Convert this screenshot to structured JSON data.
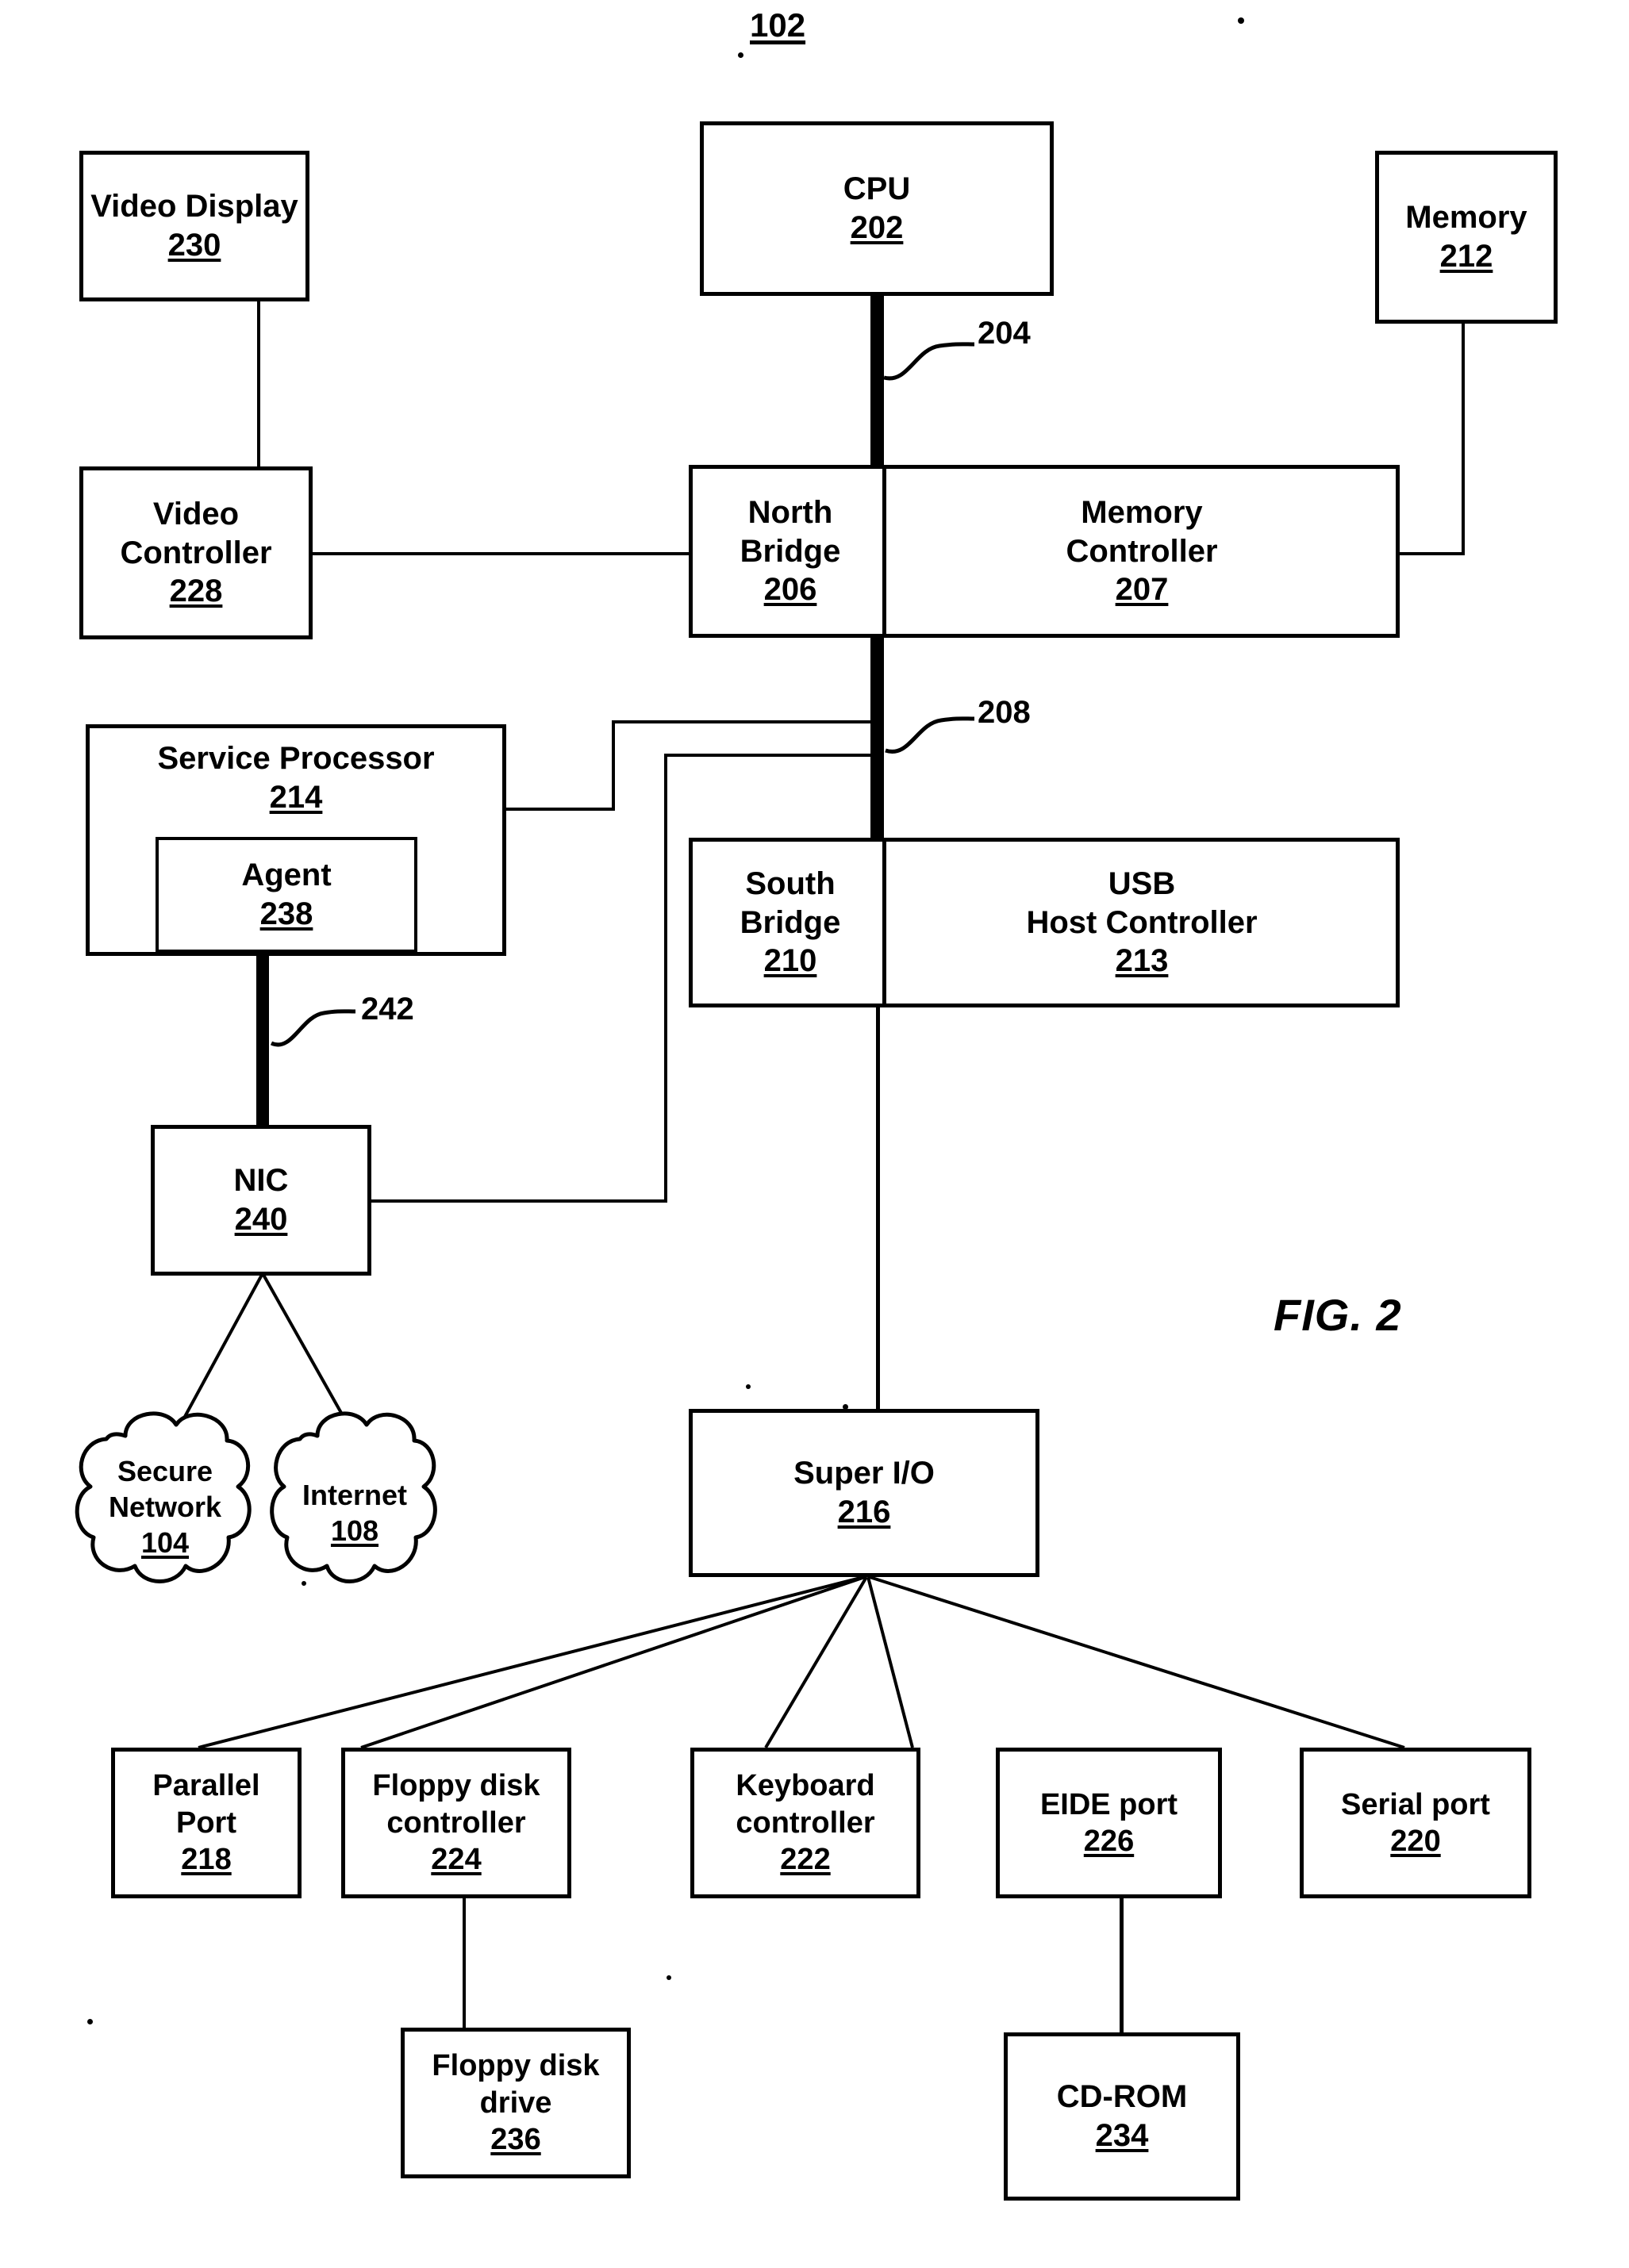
{
  "figure": {
    "system_ref": "102",
    "caption": "FIG. 2"
  },
  "blocks": {
    "video_display": {
      "title": "Video Display",
      "ref": "230"
    },
    "cpu": {
      "title": "CPU",
      "ref": "202"
    },
    "memory": {
      "title": "Memory",
      "ref": "212"
    },
    "video_controller": {
      "title": "Video Controller",
      "ref": "228"
    },
    "north_bridge": {
      "title": "North Bridge",
      "ref": "206"
    },
    "memory_controller": {
      "title": "Memory\nController",
      "ref": "207"
    },
    "memory_controller_l1": "Memory",
    "memory_controller_l2": "Controller",
    "service_processor": {
      "title": "Service Processor",
      "ref": "214"
    },
    "agent": {
      "title": "Agent",
      "ref": "238"
    },
    "south_bridge": {
      "title": "South Bridge",
      "ref": "210"
    },
    "usb_host_controller": {
      "title": "USB Host Controller",
      "ref": "213"
    },
    "usb_host_l1": "USB",
    "usb_host_l2": "Host Controller",
    "nic": {
      "title": "NIC",
      "ref": "240"
    },
    "super_io": {
      "title": "Super I/O",
      "ref": "216"
    },
    "parallel_port": {
      "title": "Parallel Port",
      "ref": "218"
    },
    "parallel_port_l1": "Parallel",
    "parallel_port_l2": "Port",
    "floppy_disk_controller": {
      "title": "Floppy disk controller",
      "ref": "224"
    },
    "floppy_disk_controller_l1": "Floppy disk",
    "floppy_disk_controller_l2": "controller",
    "keyboard_controller": {
      "title": "Keyboard controller",
      "ref": "222"
    },
    "keyboard_controller_l1": "Keyboard",
    "keyboard_controller_l2": "controller",
    "eide_port": {
      "title": "EIDE port",
      "ref": "226"
    },
    "serial_port": {
      "title": "Serial port",
      "ref": "220"
    },
    "floppy_disk_drive": {
      "title": "Floppy disk drive",
      "ref": "236"
    },
    "floppy_disk_drive_l1": "Floppy disk",
    "floppy_disk_drive_l2": "drive",
    "cdrom": {
      "title": "CD-ROM",
      "ref": "234"
    }
  },
  "clouds": {
    "secure_network": {
      "line1": "Secure",
      "line2": "Network",
      "ref": "104"
    },
    "internet": {
      "line1": "Internet",
      "ref": "108"
    }
  },
  "bus_labels": {
    "cpu_bus": "204",
    "south_bus": "208",
    "nic_bus": "242"
  },
  "colors": {
    "ink": "#000000",
    "paper": "#ffffff"
  }
}
